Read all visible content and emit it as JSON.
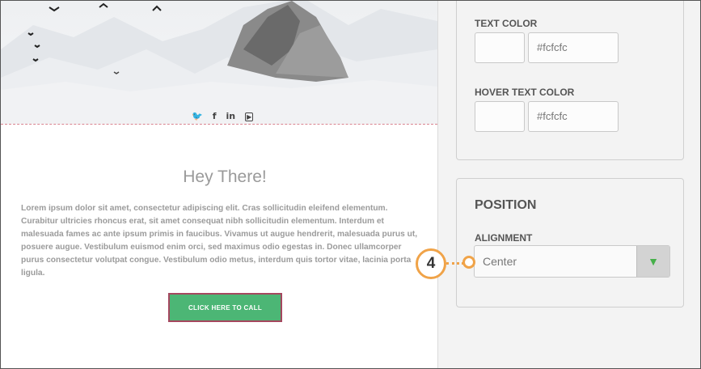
{
  "preview": {
    "social_icons": [
      "twitter-icon",
      "facebook-icon",
      "linkedin-icon",
      "youtube-icon"
    ],
    "social_glyphs": {
      "twitter": "🐦",
      "facebook": "f",
      "linkedin": "in",
      "youtube": "▶"
    },
    "heading": "Hey There!",
    "body": "Lorem ipsum dolor sit amet, consectetur adipiscing elit. Cras sollicitudin eleifend elementum. Curabitur ultricies rhoncus erat, sit amet consequat nibh sollicitudin elementum. Interdum et malesuada fames ac ante ipsum primis in faucibus. Vivamus ut augue hendrerit, malesuada purus ut, posuere augue. Vestibulum euismod enim orci, sed maximus odio egestas in. Donec ullamcorper purus consectetur volutpat congue. Vestibulum odio metus, interdum quis tortor vitae, lacinia porta ligula.",
    "cta_label": "CLICK HERE TO CALL",
    "colors": {
      "cta_bg": "#4cb675",
      "cta_border": "#a5475f",
      "divider": "#d9838f"
    }
  },
  "panel": {
    "text_color": {
      "label": "TEXT COLOR",
      "value": "#fcfcfc"
    },
    "hover_text_color": {
      "label": "HOVER TEXT COLOR",
      "value": "#fcfcfc"
    },
    "position": {
      "title": "POSITION",
      "alignment_label": "ALIGNMENT",
      "alignment_value": "Center",
      "dropdown_arrow": "▼"
    }
  },
  "callout": {
    "number": "4",
    "color": "#f0a348"
  }
}
